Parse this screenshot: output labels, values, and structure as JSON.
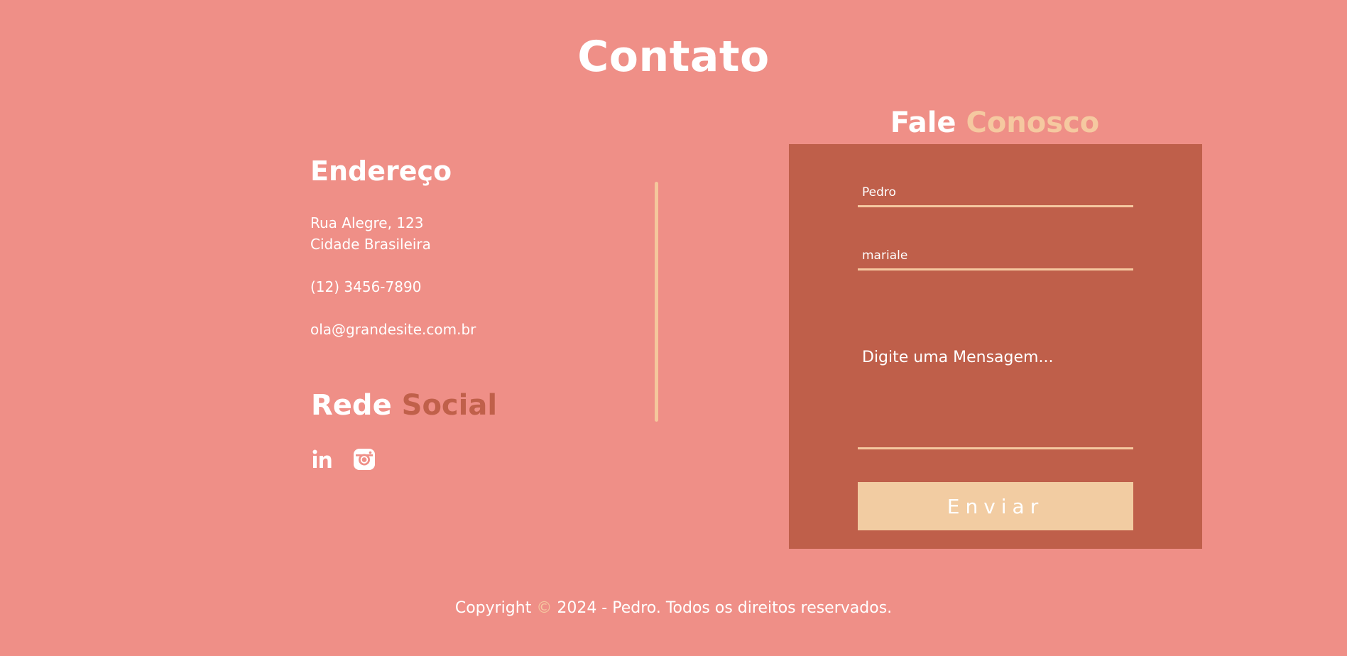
{
  "page": {
    "title": "Contato"
  },
  "address": {
    "heading": "Endereço",
    "street": "Rua Alegre, 123",
    "city": "Cidade Brasileira",
    "phone": "(12) 3456-7890",
    "email": "ola@grandesite.com.br"
  },
  "social": {
    "heading_first": "Rede",
    "heading_accent": "Social",
    "icons": [
      "linkedin-icon",
      "instagram-icon"
    ]
  },
  "form": {
    "heading_first": "Fale",
    "heading_accent": "Conosco",
    "name_value": "Pedro",
    "email_value": "mariale",
    "message_placeholder": "Digite uma Mensagem...",
    "submit_label": "Enviar"
  },
  "footer": {
    "prefix": "Copyright",
    "symbol": "©",
    "suffix": "2024 - Pedro. Todos os direitos reservados."
  },
  "colors": {
    "background": "#ef8f87",
    "panel": "#bf5f4a",
    "accent_light": "#f5c9a0",
    "accent_dark": "#c0604a",
    "button": "#f2cca2"
  }
}
